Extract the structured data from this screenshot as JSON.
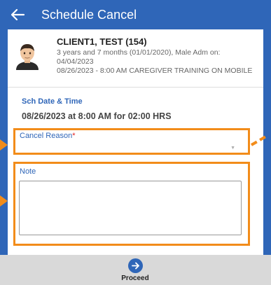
{
  "header": {
    "title": "Schedule Cancel",
    "back_icon": "arrow-left-icon"
  },
  "client": {
    "name": "CLIENT1, TEST (154)",
    "details_line1": "3 years and 7 months (01/01/2020), Male Adm on:",
    "details_line2": "04/04/2023",
    "details_line3": "08/26/2023 - 8:00 AM CAREGIVER TRAINING ON MOBILE"
  },
  "schedule": {
    "label": "Sch Date & Time",
    "value": "08/26/2023 at 8:00 AM for 02:00 HRS"
  },
  "cancel_reason": {
    "label": "Cancel Reason",
    "required_mark": "*",
    "value": ""
  },
  "note": {
    "label": "Note",
    "value": ""
  },
  "footer": {
    "proceed_label": "Proceed"
  },
  "colors": {
    "brand": "#2f66b8",
    "highlight": "#f28c1a",
    "required": "#e02020"
  }
}
